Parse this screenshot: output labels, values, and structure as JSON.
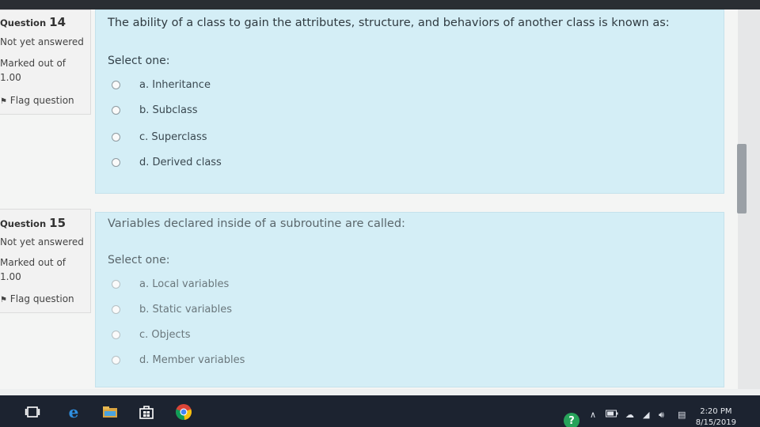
{
  "questions": [
    {
      "number_label": "Question",
      "number": "14",
      "status": "Not yet answered",
      "marked": "Marked out of",
      "marks": "1.00",
      "flag": "Flag question",
      "text": "The ability of a class to gain the attributes, structure, and behaviors of another class is known as:",
      "select": "Select one:",
      "options": [
        "a. Inheritance",
        "b. Subclass",
        "c. Superclass",
        "d. Derived class"
      ]
    },
    {
      "number_label": "Question",
      "number": "15",
      "status": "Not yet answered",
      "marked": "Marked out of",
      "marks": "1.00",
      "flag": "Flag question",
      "text": "Variables declared inside of a subroutine are called:",
      "select": "Select one:",
      "options": [
        "a. Local variables",
        "b. Static variables",
        "c. Objects",
        "d. Member variables"
      ]
    }
  ],
  "taskbar": {
    "time": "2:20 PM",
    "date": "8/15/2019",
    "help": "?"
  },
  "colors": {
    "question_bg": "#d4eef6",
    "taskbar_bg": "#1c2330"
  }
}
